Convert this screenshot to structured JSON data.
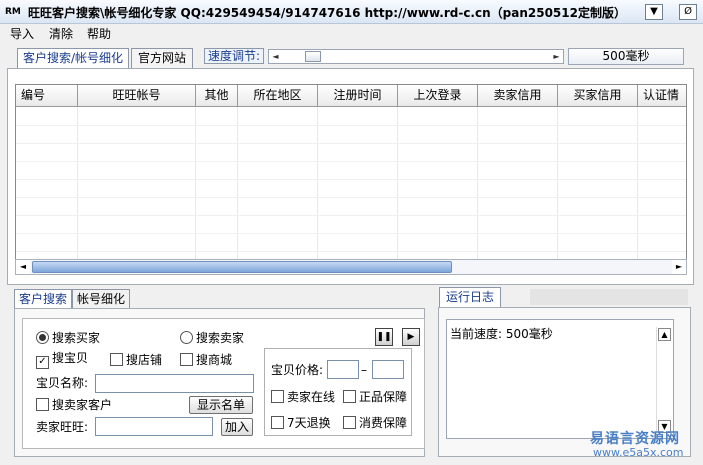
{
  "window": {
    "icon_text": "RM",
    "title": "旺旺客户搜索\\帐号细化专家 QQ:429549454/914747616 http://www.rd-c.cn（pan250512定制版）",
    "minimize_glyph": "▼",
    "close_glyph": "Ø"
  },
  "menu": [
    "导入",
    "清除",
    "帮助"
  ],
  "top_tabs": [
    "客户搜索/帐号细化",
    "官方网站"
  ],
  "speed": {
    "label": "速度调节:",
    "left_arrow": "◄",
    "right_arrow": "►",
    "value_label": "500毫秒",
    "slider_fraction": 0.1
  },
  "grid": {
    "columns": [
      "编号",
      "旺旺帐号",
      "其他",
      "所在地区",
      "注册时间",
      "上次登录",
      "卖家信用",
      "买家信用",
      "认证情"
    ],
    "rows": []
  },
  "scroll": {
    "left_arrow": "◄",
    "right_arrow": "►",
    "up_arrow": "▲",
    "down_arrow": "▼"
  },
  "bottom_tabs": [
    "客户搜索",
    "帐号细化"
  ],
  "search": {
    "radio_buyer": "搜索买家",
    "radio_buyer_selected": true,
    "radio_seller": "搜索卖家",
    "radio_seller_selected": false,
    "check_item": "搜宝贝",
    "check_item_checked": true,
    "check_shop": "搜店铺",
    "check_mall": "搜商城",
    "item_name_label": "宝贝名称:",
    "item_name_value": "",
    "search_seller_customers": "搜卖家客户",
    "show_list_button": "显示名单",
    "seller_ww_label": "卖家旺旺:",
    "seller_ww_value": "",
    "add_button": "加入",
    "pause_glyph": "❚❚",
    "play_glyph": "▶",
    "price_label": "宝贝价格:",
    "price_min": "",
    "price_sep": "–",
    "price_max": "",
    "check_online": "卖家在线",
    "check_genuine": "正品保障",
    "check_7day": "7天退换",
    "check_consumer": "消费保障"
  },
  "log": {
    "tab_label": "运行日志",
    "text": "当前速度: 500毫秒"
  },
  "watermark": {
    "cn": "易语言资源网",
    "url": "www.e5a5x.com"
  },
  "colors": {
    "accent": "#1a3d8c",
    "watermark": "#4a7fc4"
  }
}
